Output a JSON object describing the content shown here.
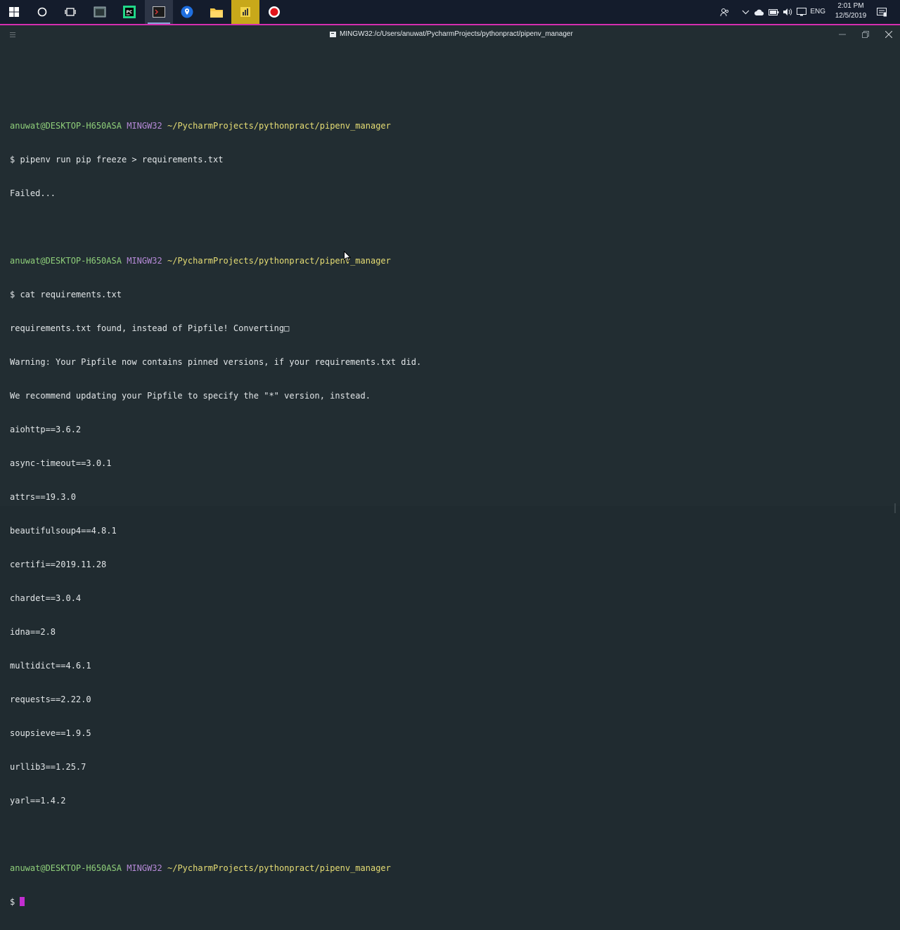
{
  "taskbar": {
    "apps": [
      {
        "name": "start",
        "icon": "windows-logo-icon"
      },
      {
        "name": "cortana",
        "icon": "search-circle-icon"
      },
      {
        "name": "task-view",
        "icon": "task-view-icon"
      },
      {
        "name": "app-generic",
        "icon": "window-app-icon"
      },
      {
        "name": "pycharm",
        "icon": "pycharm-icon"
      },
      {
        "name": "terminal",
        "icon": "terminal-icon"
      },
      {
        "name": "maps",
        "icon": "location-pin-icon"
      },
      {
        "name": "file-explorer",
        "icon": "folder-icon"
      },
      {
        "name": "media",
        "icon": "media-app-icon"
      },
      {
        "name": "record",
        "icon": "record-icon"
      }
    ],
    "tray": {
      "language": "ENG",
      "time": "2:01 PM",
      "date": "12/5/2019"
    }
  },
  "window": {
    "title": "MINGW32:/c/Users/anuwat/PycharmProjects/pythonpract/pipenv_manager"
  },
  "terminal": {
    "prompts": [
      {
        "user": "anuwat@DESKTOP-H650ASA",
        "system": "MINGW32",
        "path": "~/PycharmProjects/pythonpract/pipenv_manager"
      },
      {
        "user": "anuwat@DESKTOP-H650ASA",
        "system": "MINGW32",
        "path": "~/PycharmProjects/pythonpract/pipenv_manager"
      },
      {
        "user": "anuwat@DESKTOP-H650ASA",
        "system": "MINGW32",
        "path": "~/PycharmProjects/pythonpract/pipenv_manager"
      }
    ],
    "cmd1": "$ pipenv run pip freeze > requirements.txt",
    "out1": "Failed...",
    "cmd2": "$ cat requirements.txt",
    "out2": [
      "requirements.txt found, instead of Pipfile! Converting□",
      "Warning: Your Pipfile now contains pinned versions, if your requirements.txt did.",
      "We recommend updating your Pipfile to specify the \"*\" version, instead.",
      "aiohttp==3.6.2",
      "async-timeout==3.0.1",
      "attrs==19.3.0",
      "beautifulsoup4==4.8.1",
      "certifi==2019.11.28",
      "chardet==3.0.4",
      "idna==2.8",
      "multidict==4.6.1",
      "requests==2.22.0",
      "soupsieve==1.9.5",
      "urllib3==1.25.7",
      "yarl==1.4.2"
    ],
    "prompt_symbol": "$"
  },
  "colors": {
    "user": "#8fcf7a",
    "system": "#b68ad8",
    "path": "#e6dd74",
    "cursor": "#c22ed0",
    "window_border": "#d52eb0"
  }
}
